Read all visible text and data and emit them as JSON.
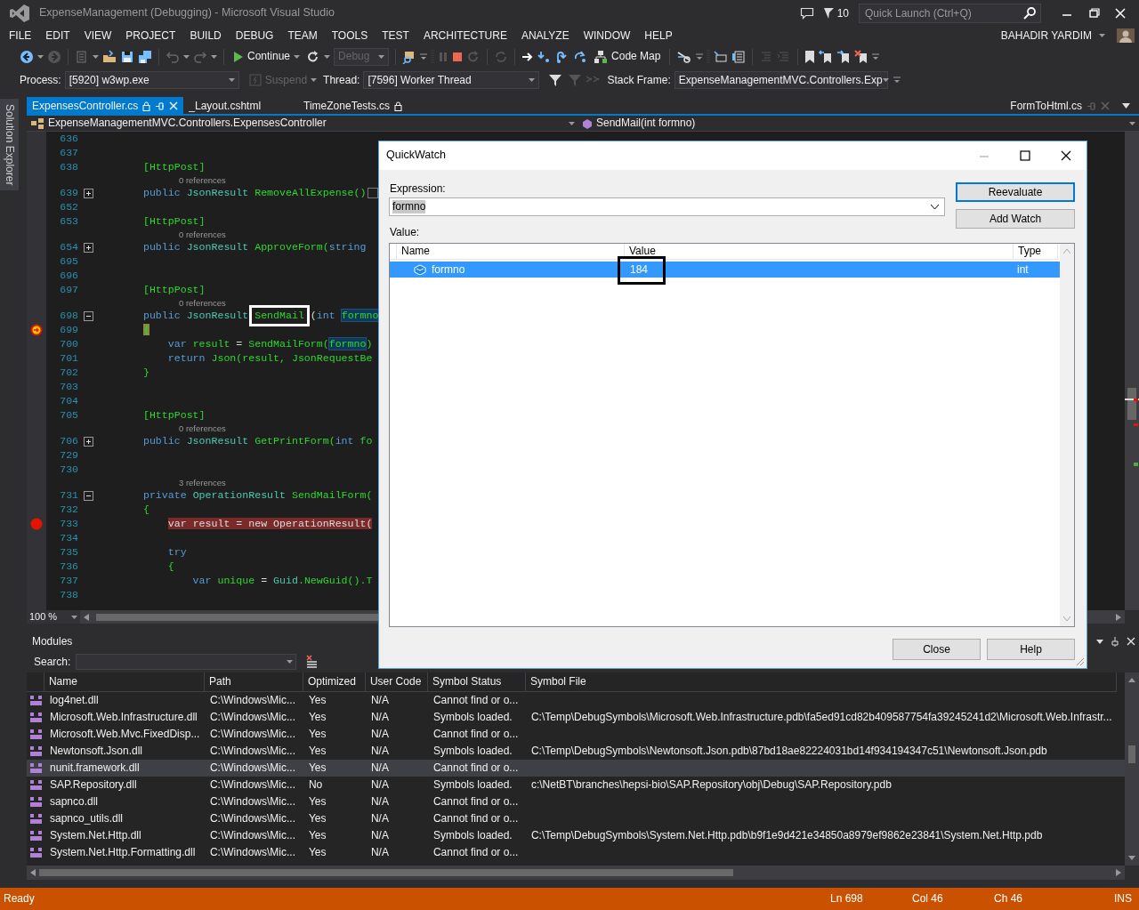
{
  "window": {
    "title": "ExpenseManagement (Debugging) - Microsoft Visual Studio",
    "notification_count": "10",
    "quick_launch": {
      "placeholder": "Quick Launch (Ctrl+Q)"
    }
  },
  "menu": [
    "FILE",
    "EDIT",
    "VIEW",
    "PROJECT",
    "BUILD",
    "DEBUG",
    "TEAM",
    "TOOLS",
    "TEST",
    "ARCHITECTURE",
    "ANALYZE",
    "WINDOW",
    "HELP"
  ],
  "user": {
    "name": "BAHADIR YARDIM"
  },
  "toolbar": {
    "continue": "Continue",
    "configuration": {
      "value": "Debug",
      "disabled": true
    },
    "code_map": "Code Map"
  },
  "debug_location": {
    "process_label": "Process:",
    "process": "[5920] w3wp.exe",
    "suspend": {
      "label": "Suspend",
      "disabled": true
    },
    "thread_label": "Thread:",
    "thread": "[7596] Worker Thread",
    "stack_frame_label": "Stack Frame:",
    "stack_frame": "ExpenseManagementMVC.Controllers.Exp"
  },
  "side_tabs": [
    "Solution Explorer"
  ],
  "editor": {
    "tabs": [
      {
        "label": "ExpensesController.cs",
        "selected": true,
        "locked": true
      },
      {
        "label": "_Layout.cshtml",
        "selected": false,
        "locked": false
      },
      {
        "label": "TimeZoneTests.cs",
        "selected": false,
        "locked": true
      }
    ],
    "overflow_tab": "FormToHtml.cs",
    "nav_type": "ExpenseManagementMVC.Controllers.ExpensesController",
    "nav_member": "SendMail(int formno)",
    "zoom": "100 %",
    "lines": [
      {
        "kind": "code",
        "number": "636"
      },
      {
        "kind": "code",
        "number": "637"
      },
      {
        "kind": "code",
        "number": "638",
        "tokens": [
          {
            "text": "[HttpPost]",
            "kind": "ident"
          }
        ]
      },
      {
        "kind": "lens",
        "text": "0 references"
      },
      {
        "kind": "code",
        "number": "639",
        "foldable": true,
        "expanded": false,
        "tokens": [
          {
            "text": "public ",
            "kind": "keyword"
          },
          {
            "text": "JsonResult ",
            "kind": "type"
          },
          {
            "text": "RemoveAllExpense()",
            "kind": "ident"
          },
          {
            "kind": "collapsed"
          }
        ]
      },
      {
        "kind": "code",
        "number": "652"
      },
      {
        "kind": "code",
        "number": "653",
        "tokens": [
          {
            "text": "[HttpPost]",
            "kind": "ident"
          }
        ]
      },
      {
        "kind": "lens",
        "text": "0 references"
      },
      {
        "kind": "code",
        "number": "654",
        "foldable": true,
        "expanded": false,
        "tokens": [
          {
            "text": "public ",
            "kind": "keyword"
          },
          {
            "text": "JsonResult ",
            "kind": "type"
          },
          {
            "text": "ApproveForm(",
            "kind": "ident"
          },
          {
            "text": "string",
            "kind": "keyword"
          }
        ]
      },
      {
        "kind": "code",
        "number": "695"
      },
      {
        "kind": "code",
        "number": "696"
      },
      {
        "kind": "code",
        "number": "697",
        "tokens": [
          {
            "text": "[HttpPost]",
            "kind": "ident"
          }
        ]
      },
      {
        "kind": "lens",
        "text": "0 references"
      },
      {
        "kind": "code",
        "number": "698",
        "foldable": true,
        "expanded": true,
        "tokens": [
          {
            "text": "public ",
            "kind": "keyword"
          },
          {
            "text": "JsonResult ",
            "kind": "type"
          },
          {
            "text": "SendMail",
            "kind": "framed"
          },
          {
            "text": "(",
            "kind": "plain"
          },
          {
            "text": "int ",
            "kind": "keyword"
          },
          {
            "text": "formno",
            "kind": "reference"
          }
        ]
      },
      {
        "kind": "code",
        "number": "699",
        "breakpoint": true,
        "current_statement": true,
        "tokens": [
          {
            "text": "{",
            "kind": "brace"
          }
        ]
      },
      {
        "kind": "code",
        "number": "700",
        "tokens": [
          {
            "text": "    var ",
            "kind": "keyword"
          },
          {
            "text": "result",
            "kind": "ident"
          },
          {
            "text": " = ",
            "kind": "plain"
          },
          {
            "text": "SendMailForm(",
            "kind": "ident"
          },
          {
            "text": "formno",
            "kind": "reference"
          },
          {
            "text": ")",
            "kind": "ident"
          }
        ]
      },
      {
        "kind": "code",
        "number": "701",
        "tokens": [
          {
            "text": "    return ",
            "kind": "keyword"
          },
          {
            "text": "Json(result, JsonRequestBe",
            "kind": "ident"
          }
        ]
      },
      {
        "kind": "code",
        "number": "702",
        "tokens": [
          {
            "text": "}",
            "kind": "ident"
          }
        ]
      },
      {
        "kind": "code",
        "number": "703"
      },
      {
        "kind": "code",
        "number": "704"
      },
      {
        "kind": "code",
        "number": "705",
        "tokens": [
          {
            "text": "[HttpPost]",
            "kind": "ident"
          }
        ]
      },
      {
        "kind": "lens",
        "text": "0 references"
      },
      {
        "kind": "code",
        "number": "706",
        "foldable": true,
        "expanded": false,
        "tokens": [
          {
            "text": "public ",
            "kind": "keyword"
          },
          {
            "text": "JsonResult ",
            "kind": "type"
          },
          {
            "text": "GetPrintForm(",
            "kind": "ident"
          },
          {
            "text": "int ",
            "kind": "keyword"
          },
          {
            "text": "fo",
            "kind": "ident"
          }
        ]
      },
      {
        "kind": "code",
        "number": "729"
      },
      {
        "kind": "code",
        "number": "730"
      },
      {
        "kind": "lens",
        "text": "3 references"
      },
      {
        "kind": "code",
        "number": "731",
        "foldable": true,
        "expanded": true,
        "tokens": [
          {
            "text": "private ",
            "kind": "keyword"
          },
          {
            "text": "OperationResult ",
            "kind": "type"
          },
          {
            "text": "SendMailForm(",
            "kind": "ident"
          }
        ]
      },
      {
        "kind": "code",
        "number": "732",
        "tokens": [
          {
            "text": "{",
            "kind": "ident"
          }
        ]
      },
      {
        "kind": "code",
        "number": "733",
        "breakpoint": true,
        "current_statement": false,
        "tokens": [
          {
            "text": "    var result = new OperationResult(",
            "kind": "plain"
          }
        ]
      },
      {
        "kind": "code",
        "number": "734"
      },
      {
        "kind": "code",
        "number": "735",
        "tokens": [
          {
            "text": "    try",
            "kind": "keyword"
          }
        ]
      },
      {
        "kind": "code",
        "number": "736",
        "tokens": [
          {
            "text": "    {",
            "kind": "ident"
          }
        ]
      },
      {
        "kind": "code",
        "number": "737",
        "tokens": [
          {
            "text": "        var ",
            "kind": "keyword"
          },
          {
            "text": "unique",
            "kind": "ident"
          },
          {
            "text": " = ",
            "kind": "plain"
          },
          {
            "text": "Guid",
            "kind": "type"
          },
          {
            "text": ".NewGuid().T",
            "kind": "ident"
          }
        ]
      },
      {
        "kind": "code",
        "number": "738"
      }
    ]
  },
  "modules": {
    "title": "Modules",
    "search_label": "Search:",
    "columns": [
      "Name",
      "Path",
      "Optimized",
      "User Code",
      "Symbol Status",
      "Symbol File"
    ],
    "rows": [
      {
        "name": "log4net.dll",
        "path": "C:\\Windows\\Mic...",
        "optimized": "Yes",
        "user_code": "N/A",
        "symbol_status": "Cannot find or o...",
        "selected": false
      },
      {
        "name": "Microsoft.Web.Infrastructure.dll",
        "path": "C:\\Windows\\Mic...",
        "optimized": "Yes",
        "user_code": "N/A",
        "symbol_status": "Symbols loaded.",
        "symbol_file": "C:\\Temp\\DebugSymbols\\Microsoft.Web.Infrastructure.pdb\\fa5ed91cd82b409587754fa39245241d2\\Microsoft.Web.Infrastr...",
        "selected": false
      },
      {
        "name": "Microsoft.Web.Mvc.FixedDisp...",
        "path": "C:\\Windows\\Mic...",
        "optimized": "Yes",
        "user_code": "N/A",
        "symbol_status": "Cannot find or o...",
        "selected": false
      },
      {
        "name": "Newtonsoft.Json.dll",
        "path": "C:\\Windows\\Mic...",
        "optimized": "Yes",
        "user_code": "N/A",
        "symbol_status": "Symbols loaded.",
        "symbol_file": "C:\\Temp\\DebugSymbols\\Newtonsoft.Json.pdb\\87bd18ae82224031bd14f934194347c51\\Newtonsoft.Json.pdb",
        "selected": false
      },
      {
        "name": "nunit.framework.dll",
        "path": "C:\\Windows\\Mic...",
        "optimized": "Yes",
        "user_code": "N/A",
        "symbol_status": "Cannot find or o...",
        "selected": true
      },
      {
        "name": "SAP.Repository.dll",
        "path": "C:\\Windows\\Mic...",
        "optimized": "No",
        "user_code": "N/A",
        "symbol_status": "Symbols loaded.",
        "symbol_file": "c:\\NetBT\\branches\\hepsi-bio\\SAP.Repository\\obj\\Debug\\SAP.Repository.pdb",
        "selected": false
      },
      {
        "name": "sapnco.dll",
        "path": "C:\\Windows\\Mic...",
        "optimized": "Yes",
        "user_code": "N/A",
        "symbol_status": "Cannot find or o...",
        "selected": false
      },
      {
        "name": "sapnco_utils.dll",
        "path": "C:\\Windows\\Mic...",
        "optimized": "Yes",
        "user_code": "N/A",
        "symbol_status": "Cannot find or o...",
        "selected": false
      },
      {
        "name": "System.Net.Http.dll",
        "path": "C:\\Windows\\Mic...",
        "optimized": "Yes",
        "user_code": "N/A",
        "symbol_status": "Symbols loaded.",
        "symbol_file": "C:\\Temp\\DebugSymbols\\System.Net.Http.pdb\\b9f1e9d421e34850a8979ef9862e23841\\System.Net.Http.pdb",
        "selected": false
      },
      {
        "name": "System.Net.Http.Formatting.dll",
        "path": "C:\\Windows\\Mic...",
        "optimized": "Yes",
        "user_code": "N/A",
        "symbol_status": "Cannot find or o...",
        "selected": false
      }
    ]
  },
  "quickwatch": {
    "title": "QuickWatch",
    "expression_label": "Expression:",
    "expression": "formno",
    "value_label": "Value:",
    "buttons": [
      {
        "label": "Reevaluate",
        "default": true
      },
      {
        "label": "Add Watch",
        "default": false
      }
    ],
    "columns": [
      "Name",
      "Value",
      "Type"
    ],
    "rows": [
      {
        "name": "formno",
        "value": "184",
        "type": "int",
        "selected": true
      }
    ],
    "footer_buttons": [
      "Close",
      "Help"
    ]
  },
  "status_bar": {
    "state": "Ready",
    "items": [
      "Ln 698",
      "Col 46",
      "Ch 46",
      "INS"
    ]
  }
}
